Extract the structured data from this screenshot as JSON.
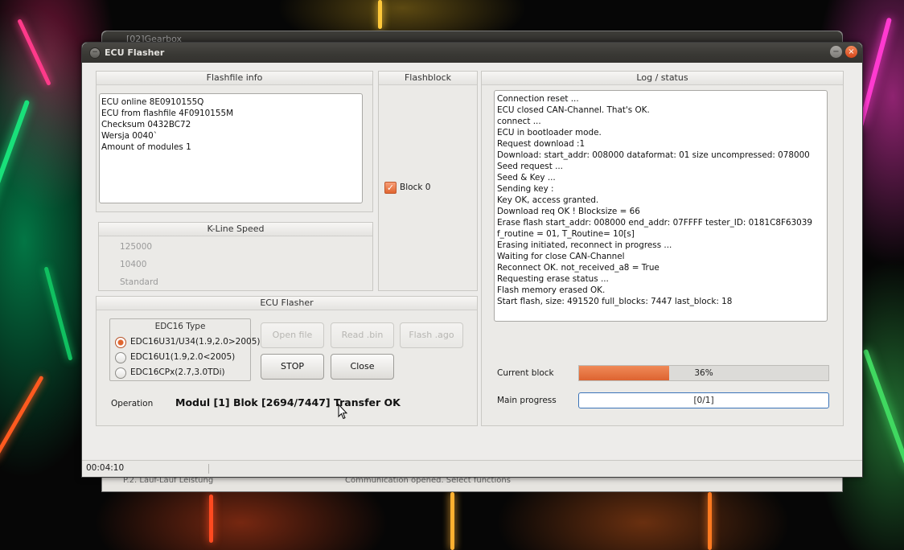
{
  "background_window": {
    "title": "[02]Gearbox",
    "status_left": "P.2. Lauf-Lauf Leistung",
    "status_right": "Communication opened. Select functions"
  },
  "window": {
    "title": "ECU Flasher",
    "minimize_glyph": "−",
    "close_glyph": "×"
  },
  "flashfile_info": {
    "title": "Flashfile info",
    "lines": [
      "ECU online 8E0910155Q",
      "ECU from flashfile 4F0910155M",
      "Checksum 0432BC72",
      "Wersja 0040`",
      "Amount of modules 1"
    ]
  },
  "flashblock": {
    "title": "Flashblock",
    "block_label": "Block 0",
    "checked": true
  },
  "kline": {
    "title": "K-Line Speed",
    "options": [
      "125000",
      "10400",
      "Standard"
    ]
  },
  "ecu_flasher": {
    "title": "ECU Flasher",
    "edc_group_title": "EDC16 Type",
    "edc_options": [
      {
        "label": "EDC16U31/U34(1.9,2.0>2005)",
        "selected": true
      },
      {
        "label": "EDC16U1(1.9,2.0<2005)",
        "selected": false
      },
      {
        "label": "EDC16CPx(2.7,3.0TDi)",
        "selected": false
      }
    ],
    "buttons": {
      "open_file": "Open file",
      "read_bin": "Read .bin",
      "flash_ago": "Flash .ago",
      "stop": "STOP",
      "close": "Close"
    },
    "operation_label": "Operation",
    "operation_text": "Modul [1] Blok [2694/7447] Transfer OK"
  },
  "log": {
    "title": "Log / status",
    "lines": [
      "Connection reset ...",
      "ECU closed CAN-Channel. That's OK.",
      "connect ...",
      "ECU in bootloader mode.",
      "Request download :1",
      "Download: start_addr: 008000 dataformat: 01 size uncompressed: 078000",
      "Seed request ...",
      "Seed & Key ...",
      "Sending key :",
      "Key OK, access granted.",
      "Download req OK ! Blocksize = 66",
      "Erase flash start_addr: 008000 end_addr: 07FFFF tester_ID: 0181C8F63039",
      "f_routine = 01, T_Routine= 10[s]",
      "Erasing initiated, reconnect in progress ...",
      "Waiting for close CAN-Channel",
      "Reconnect OK. not_received_a8 = True",
      "Requesting erase status ...",
      "Flash memory erased OK.",
      "Start flash, size: 491520 full_blocks: 7447 last_block: 18"
    ]
  },
  "progress": {
    "current_block_label": "Current block",
    "current_block_text": "36%",
    "current_block_fraction": 0.36,
    "main_progress_label": "Main progress",
    "main_progress_text": "[0/1]",
    "main_progress_fraction": 0
  },
  "statusbar": {
    "elapsed": "00:04:10"
  },
  "colors": {
    "accent": "#e0652f",
    "titlebar": "#3a3935",
    "window_bg": "#edecea"
  }
}
